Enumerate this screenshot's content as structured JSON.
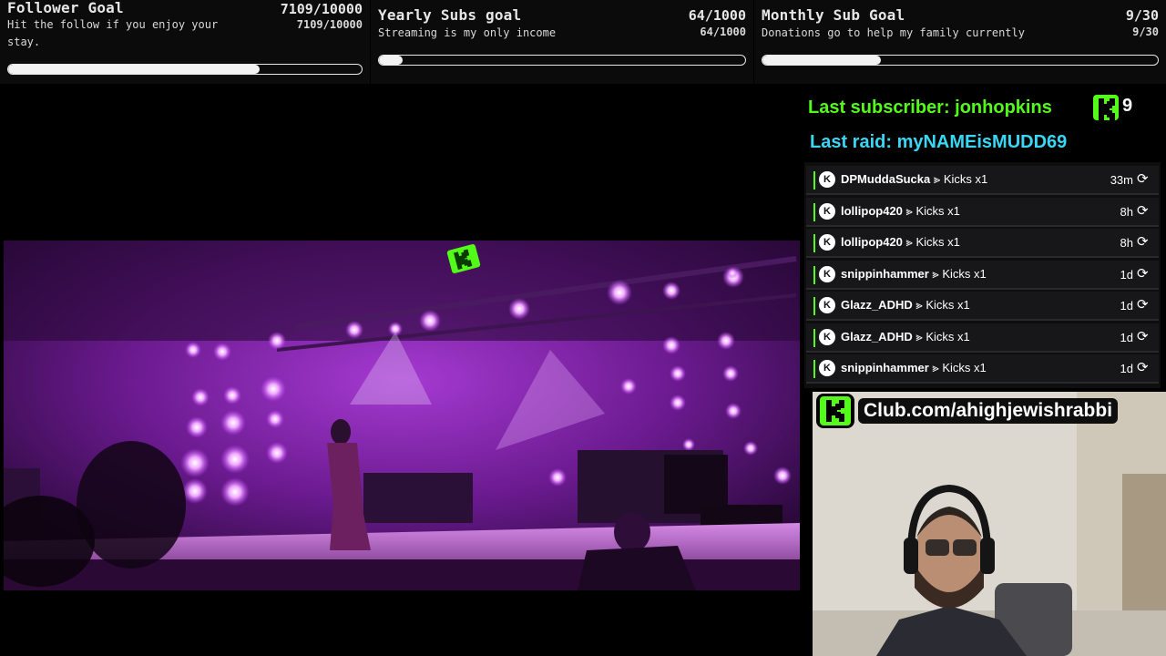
{
  "goals": [
    {
      "title": "Follower Goal",
      "count": "7109/10000",
      "subtitle": "Hit the follow if you enjoy your stay.",
      "subcount": "7109/10000",
      "progress": 0.711
    },
    {
      "title": "Yearly Subs goal",
      "count": "64/1000",
      "subtitle": "Streaming is my only income",
      "subcount": "64/1000",
      "progress": 0.064
    },
    {
      "title": "Monthly Sub Goal",
      "count": "9/30",
      "subtitle": "Donations go to help my family currently",
      "subcount": "9/30",
      "progress": 0.3
    }
  ],
  "last_subscriber": "Last subscriber: jonhopkins",
  "last_raid": "Last raid: myNAMEisMUDD69",
  "sub_count": "9",
  "events": [
    {
      "user": "DPMuddaSucka",
      "action": "⪢ Kicks x1",
      "time": "33m"
    },
    {
      "user": "lollipop420",
      "action": "⪢ Kicks x1",
      "time": "8h"
    },
    {
      "user": "lollipop420",
      "action": "⪢ Kicks x1",
      "time": "8h"
    },
    {
      "user": "snippinhammer",
      "action": "⪢ Kicks x1",
      "time": "1d"
    },
    {
      "user": "Glazz_ADHD",
      "action": "⪢ Kicks x1",
      "time": "1d"
    },
    {
      "user": "Glazz_ADHD",
      "action": "⪢ Kicks x1",
      "time": "1d"
    },
    {
      "user": "snippinhammer",
      "action": "⪢ Kicks x1",
      "time": "1d"
    }
  ],
  "event_icon": "K",
  "club_link": "Club.com/ahighjewishrabbi",
  "colors": {
    "kick_green": "#53fc18",
    "raid_cyan": "#39d7f5"
  }
}
